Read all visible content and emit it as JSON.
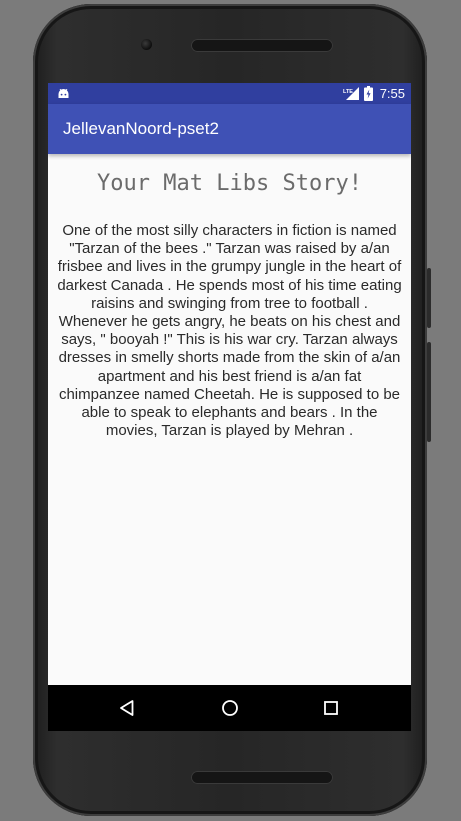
{
  "status_bar": {
    "time": "7:55",
    "network_label": "LTE",
    "icons": [
      "android-notification-icon",
      "lte-signal-icon",
      "battery-charging-icon"
    ]
  },
  "app_bar": {
    "title": "JellevanNoord-pset2"
  },
  "story": {
    "title": "Your Mat Libs Story!",
    "text": "One of the most silly characters in fiction is named \"Tarzan of the bees .\" Tarzan was raised by a/an frisbee and lives in the grumpy jungle in the heart of darkest Canada . He spends most of his time eating raisins and swinging from tree to football . Whenever he gets angry, he beats on his chest and says, \" booyah !\" This is his war cry. Tarzan always dresses in smelly shorts made from the skin of a/an apartment and his best friend is a/an fat chimpanzee named Cheetah. He is supposed to be able to speak to elephants and bears . In the movies, Tarzan is played by Mehran ."
  },
  "nav_bar": {
    "icons": [
      "back-icon",
      "home-icon",
      "recents-icon"
    ]
  },
  "colors": {
    "status_bar": "#303f9f",
    "app_bar": "#3f51b5",
    "background": "#fafafa",
    "title_text": "#6b6b6b",
    "body_text": "#2a2a2a",
    "nav_bar": "#000000"
  }
}
